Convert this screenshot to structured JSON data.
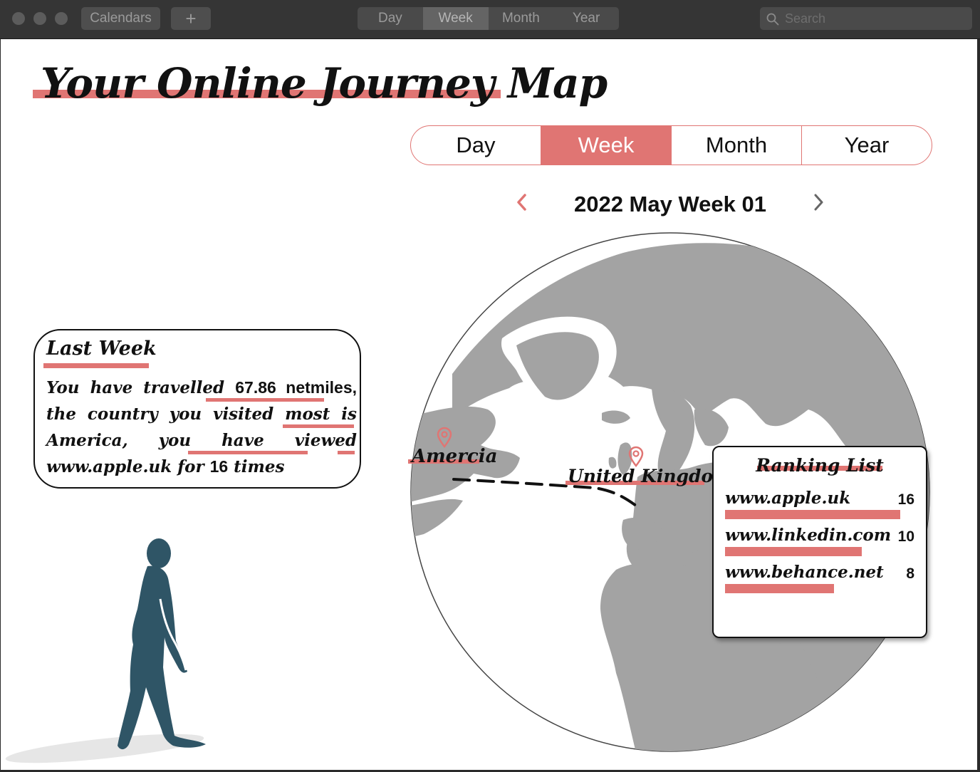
{
  "toolbar": {
    "calendars_label": "Calendars",
    "add_label": "+",
    "views": [
      "Day",
      "Week",
      "Month",
      "Year"
    ],
    "active_view": "Week",
    "search_placeholder": "Search"
  },
  "page": {
    "title": "Your Online Journey Map",
    "segments": [
      "Day",
      "Week",
      "Month",
      "Year"
    ],
    "active_segment": "Week",
    "period_label": "2022 May Week 01",
    "prev_icon": "chevron-left-icon",
    "next_icon": "chevron-right-icon",
    "accent_color": "#e07573"
  },
  "summary": {
    "title": "Last Week",
    "text_1": "You have travelled ",
    "distance": "67.86 netmiles,",
    "text_2": " the country you visited most is ",
    "country": "America,",
    "text_3": " you have viewed ",
    "site": "www.apple.uk",
    "text_4": " for ",
    "views": "16",
    "text_5": " times"
  },
  "map": {
    "locations": [
      "Amercia",
      "United Kingdom"
    ],
    "pin_icon": "map-pin-icon"
  },
  "ranking": {
    "title": "Ranking List",
    "items": [
      {
        "site": "www.apple.uk",
        "count": "16",
        "share": 1.0
      },
      {
        "site": "www.linkedin.com",
        "count": "10",
        "share": 0.78
      },
      {
        "site": "www.behance.net",
        "count": "8",
        "share": 0.62
      }
    ]
  }
}
